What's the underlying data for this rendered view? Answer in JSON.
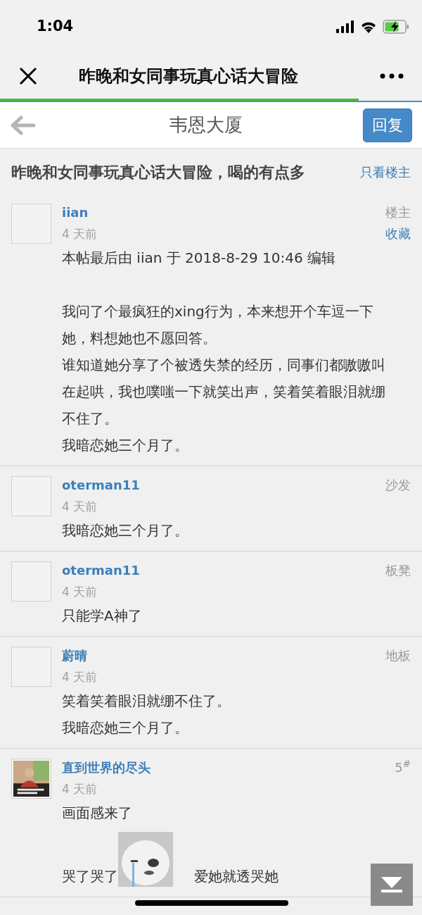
{
  "status_bar": {
    "time": "1:04"
  },
  "nav": {
    "title": "昨晚和女同事玩真心话大冒险",
    "load_progress": {
      "level": 0.85
    }
  },
  "header": {
    "title": "韦恩大厦",
    "reply_button": "回复"
  },
  "thread": {
    "title": "昨晚和女同事玩真心话大冒险，喝的有点多",
    "op_only_link": "只看楼主"
  },
  "posts": [
    {
      "author": "iian",
      "time": "4 天前",
      "floor": "楼主",
      "favorite": "收藏",
      "has_photo": false,
      "blocks": [
        {
          "kind": "note",
          "text": "本帖最后由 iian 于 2018-8-29 10:46 编辑"
        },
        {
          "kind": "text",
          "text": "我问了个最疯狂的xing行为，本来想开个车逗一下她，料想她也不愿回答。"
        },
        {
          "kind": "text",
          "text": "谁知道她分享了个被透失禁的经历，同事们都嗷嗷叫在起哄，我也噗嗤一下就笑出声，笑着笑着眼泪就绷不住了。"
        },
        {
          "kind": "text",
          "text": "我暗恋她三个月了。"
        }
      ]
    },
    {
      "author": "oterman11",
      "time": "4 天前",
      "floor": "沙发",
      "has_photo": false,
      "blocks": [
        {
          "kind": "text",
          "text": "我暗恋她三个月了。"
        }
      ]
    },
    {
      "author": "oterman11",
      "time": "4 天前",
      "floor": "板凳",
      "has_photo": false,
      "blocks": [
        {
          "kind": "text",
          "text": "只能学A神了"
        }
      ]
    },
    {
      "author": "蔚晴",
      "time": "4 天前",
      "floor": "地板",
      "has_photo": false,
      "blocks": [
        {
          "kind": "text",
          "text": "笑着笑着眼泪就绷不住了。"
        },
        {
          "kind": "text",
          "text": "我暗恋她三个月了。"
        }
      ]
    },
    {
      "author": "直到世界的尽头",
      "time": "4 天前",
      "floor": "5$^{#}$",
      "has_photo": true,
      "blocks": [
        {
          "kind": "text",
          "text": "画面感来了"
        },
        {
          "kind": "sticker_line",
          "before": "哭了哭了",
          "after": "爱她就透哭她"
        }
      ]
    }
  ]
}
